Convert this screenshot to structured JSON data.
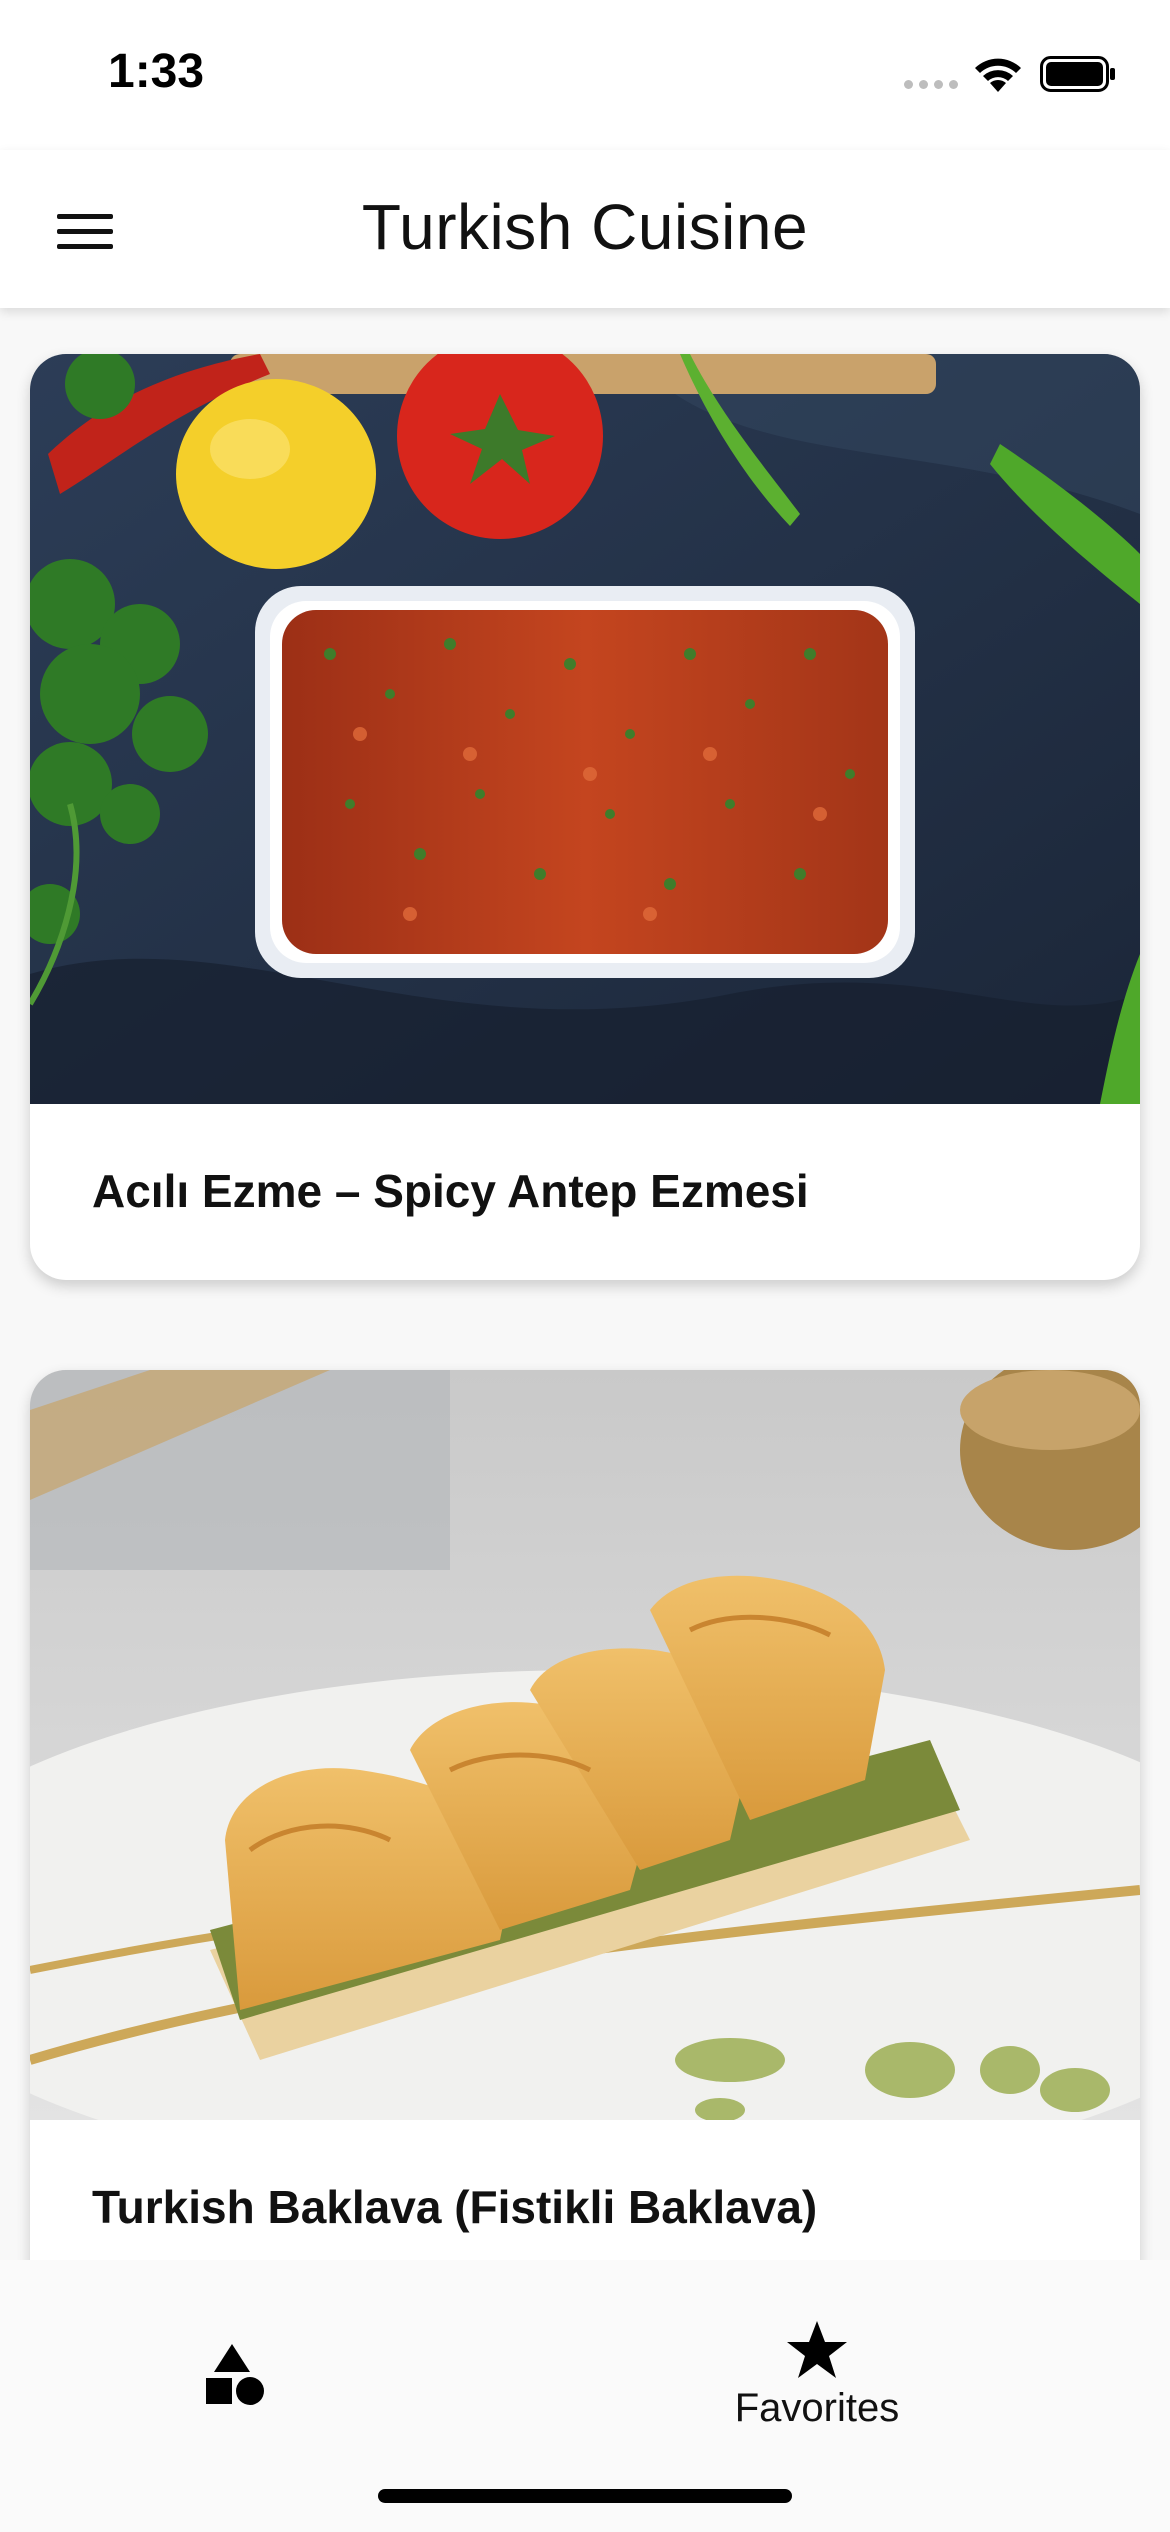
{
  "status_bar": {
    "time": "1:33"
  },
  "app_bar": {
    "title": "Turkish Cuisine",
    "menu_icon": "hamburger-menu-icon"
  },
  "recipes": [
    {
      "title": "Acılı Ezme – Spicy Antep Ezmesi",
      "image": "spicy-ezme-dish-photo"
    },
    {
      "title": "Turkish Baklava (Fistikli Baklava)",
      "image": "pistachio-baklava-photo"
    }
  ],
  "tab_bar": {
    "tabs": [
      {
        "label": "",
        "icon": "shapes-icon",
        "selected": true
      },
      {
        "label": "Favorites",
        "icon": "star-icon",
        "selected": false
      }
    ]
  },
  "colors": {
    "background": "#f8f8f8",
    "surface": "#ffffff",
    "text": "#111111"
  }
}
